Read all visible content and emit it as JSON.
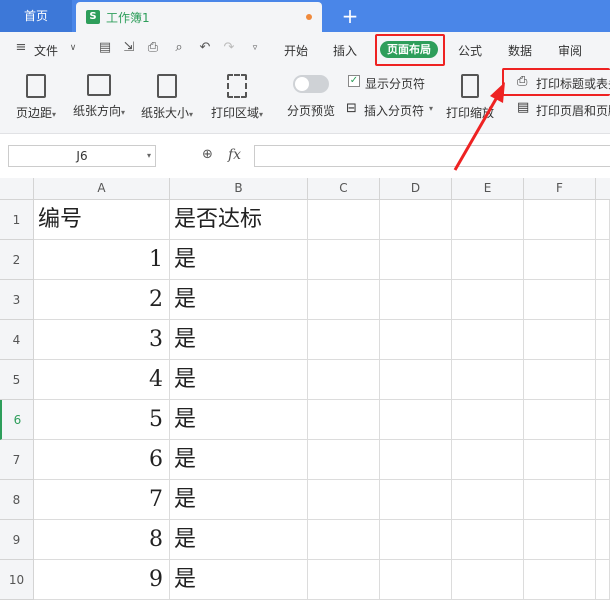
{
  "tabs": {
    "home": "首页",
    "document": "工作簿1",
    "doc_icon": "S"
  },
  "menu": {
    "file": "文件",
    "items": [
      "开始",
      "插入",
      "页面布局",
      "公式",
      "数据",
      "审阅"
    ],
    "active": "页面布局"
  },
  "ribbon": {
    "margins": "页边距",
    "orientation": "纸张方向",
    "size": "纸张大小",
    "print_area": "打印区域",
    "page_break_preview": "分页预览",
    "show_page_breaks": "显示分页符",
    "insert_page_break": "插入分页符",
    "print_scaling": "打印缩放",
    "print_titles": "打印标题或表头",
    "print_header_footer": "打印页眉和页脚"
  },
  "formula_bar": {
    "name_box": "J6",
    "fx": "fx",
    "value": ""
  },
  "columns": [
    "A",
    "B",
    "C",
    "D",
    "E",
    "F"
  ],
  "rows": [
    "1",
    "2",
    "3",
    "4",
    "5",
    "6",
    "7",
    "8",
    "9",
    "10"
  ],
  "selected_row": "6",
  "cells": {
    "header": [
      "编号",
      "是否达标"
    ],
    "data": [
      [
        "1",
        "是"
      ],
      [
        "2",
        "是"
      ],
      [
        "3",
        "是"
      ],
      [
        "4",
        "是"
      ],
      [
        "5",
        "是"
      ],
      [
        "6",
        "是"
      ],
      [
        "7",
        "是"
      ],
      [
        "8",
        "是"
      ],
      [
        "9",
        "是"
      ]
    ]
  },
  "colors": {
    "accent_green": "#2e9e5b",
    "tab_blue": "#4a86e8",
    "highlight_red": "#e22222"
  }
}
